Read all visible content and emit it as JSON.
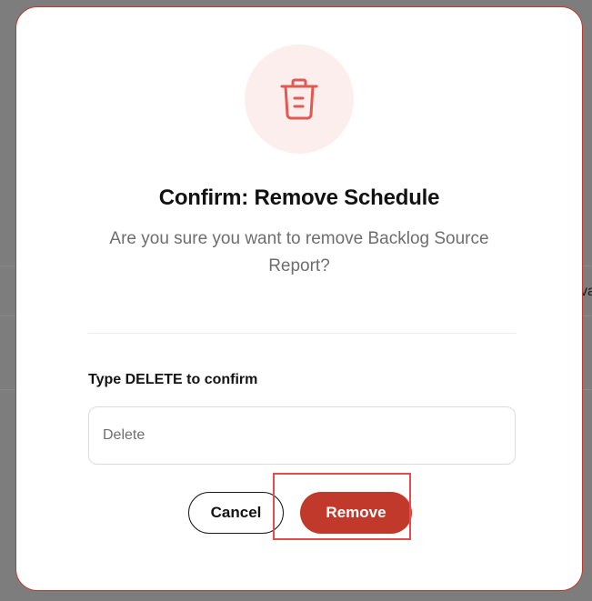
{
  "background": {
    "fragment_text": "va"
  },
  "dialog": {
    "icon": "trash-icon",
    "title": "Confirm: Remove Schedule",
    "message": "Are you sure you want to remove Backlog Source Report?",
    "confirm_label": "Type DELETE to confirm",
    "input": {
      "value": "",
      "placeholder": "Delete"
    },
    "cancel_label": "Cancel",
    "remove_label": "Remove"
  },
  "colors": {
    "accent": "#c0392b",
    "icon_bg": "#fdeeee",
    "icon_stroke": "#e05a52",
    "highlight": "#e74c4c"
  }
}
